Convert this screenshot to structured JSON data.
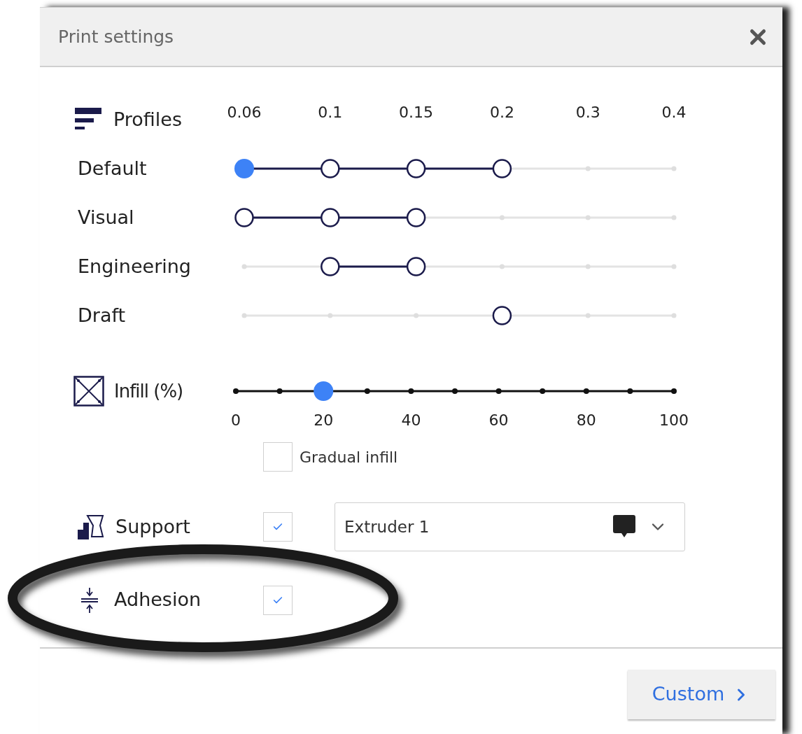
{
  "dialog": {
    "title": "Print settings"
  },
  "profiles": {
    "label": "Profiles",
    "layer_heights": [
      "0.06",
      "0.1",
      "0.15",
      "0.2",
      "0.3",
      "0.4"
    ],
    "rows": [
      {
        "name": "Default",
        "layers": [
          {
            "available": true,
            "selected": true
          },
          {
            "available": true,
            "selected": false
          },
          {
            "available": true,
            "selected": false
          },
          {
            "available": true,
            "selected": false
          },
          {
            "available": false,
            "selected": false
          },
          {
            "available": false,
            "selected": false
          }
        ]
      },
      {
        "name": "Visual",
        "layers": [
          {
            "available": true,
            "selected": false
          },
          {
            "available": true,
            "selected": false
          },
          {
            "available": true,
            "selected": false
          },
          {
            "available": false,
            "selected": false
          },
          {
            "available": false,
            "selected": false
          },
          {
            "available": false,
            "selected": false
          }
        ]
      },
      {
        "name": "Engineering",
        "layers": [
          {
            "available": false,
            "selected": false
          },
          {
            "available": true,
            "selected": false
          },
          {
            "available": true,
            "selected": false
          },
          {
            "available": false,
            "selected": false
          },
          {
            "available": false,
            "selected": false
          },
          {
            "available": false,
            "selected": false
          }
        ]
      },
      {
        "name": "Draft",
        "layers": [
          {
            "available": false,
            "selected": false
          },
          {
            "available": false,
            "selected": false
          },
          {
            "available": false,
            "selected": false
          },
          {
            "available": true,
            "selected": false
          },
          {
            "available": false,
            "selected": false
          },
          {
            "available": false,
            "selected": false
          }
        ]
      }
    ]
  },
  "infill": {
    "label": "Infill (%)",
    "level": 0.2,
    "tick_labels": [
      "0",
      "20",
      "40",
      "60",
      "80",
      "100"
    ],
    "gradual": {
      "label": "Gradual infill",
      "checked": false
    }
  },
  "support": {
    "label": "Support",
    "checked": true,
    "extruder": {
      "value": "Extruder 1"
    }
  },
  "adhesion": {
    "label": "Adhesion",
    "checked": true
  },
  "custom_button": {
    "label": "Custom"
  }
}
